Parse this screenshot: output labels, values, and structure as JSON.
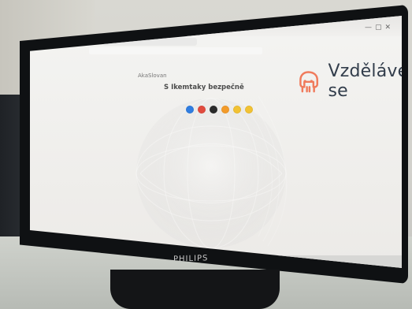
{
  "photo": {
    "device_brand": "PHILIPS"
  },
  "browser": {
    "tab_label": "",
    "url": "",
    "window_controls": [
      "minimize",
      "maximize",
      "close"
    ]
  },
  "page": {
    "small_brand": "AkaSlovan",
    "headline": "S Ikemtaky bezpečně",
    "subtitle_lines": [
      "",
      ""
    ],
    "emoji_reactions": [
      {
        "name": "blue-reaction",
        "color": "#2f7de1"
      },
      {
        "name": "red-reaction",
        "color": "#e14b3e"
      },
      {
        "name": "dark-reaction",
        "color": "#2a2a2a"
      },
      {
        "name": "orange-reaction",
        "color": "#f39b2a"
      },
      {
        "name": "yellow-reaction-1",
        "color": "#f2c233"
      },
      {
        "name": "yellow-reaction-2",
        "color": "#f2c233"
      }
    ]
  },
  "right_brand": {
    "text": "Vzdělávej se",
    "accent_color": "#f07b5c"
  },
  "taskbar": {
    "left_icons": [
      "start",
      "search",
      "taskview",
      "browser",
      "files",
      "chrome"
    ],
    "right_time": "",
    "right_date": ""
  }
}
